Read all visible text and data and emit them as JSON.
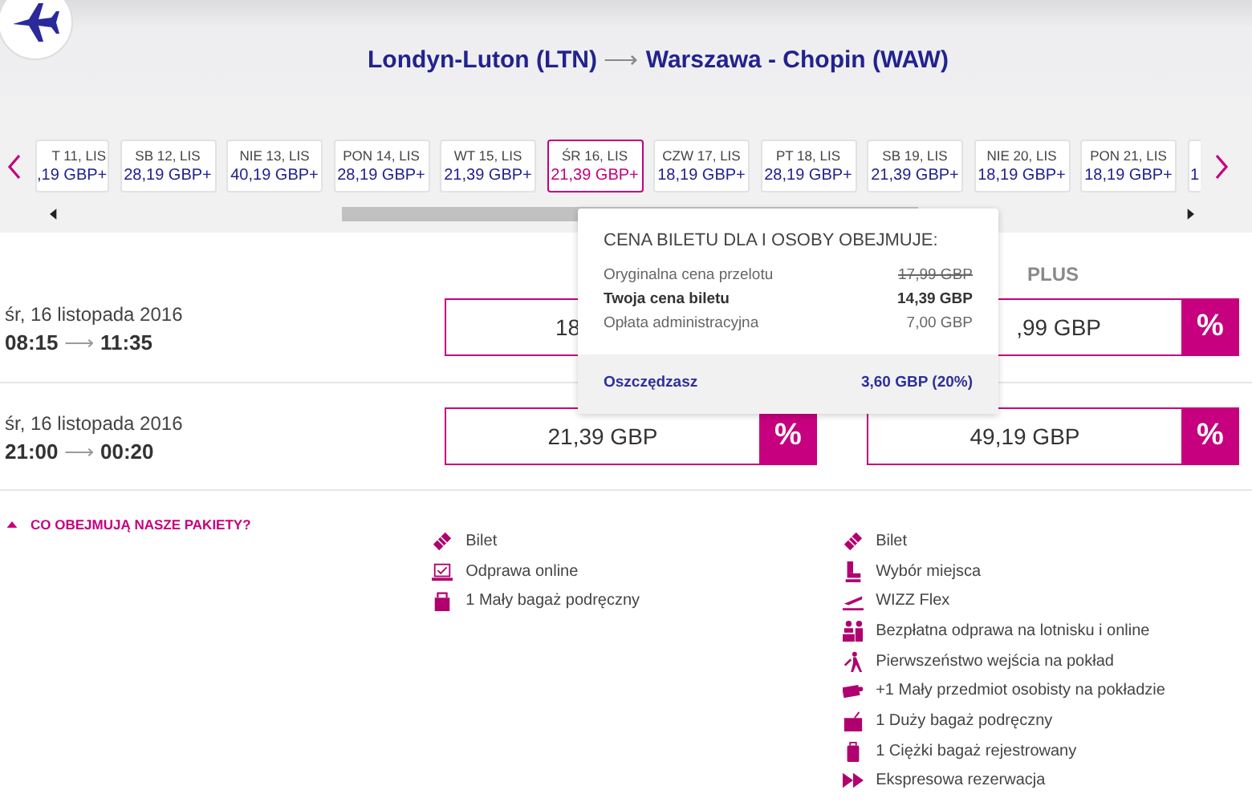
{
  "route": {
    "from": "Londyn-Luton (LTN)",
    "arrow": "⟶",
    "to": "Warszawa - Chopin (WAW)"
  },
  "dates": [
    {
      "day": "T 11, LIS",
      "price": ",19 GBP+",
      "selected": false
    },
    {
      "day": "SB 12, LIS",
      "price": "28,19 GBP+",
      "selected": false
    },
    {
      "day": "NIE 13, LIS",
      "price": "40,19 GBP+",
      "selected": false
    },
    {
      "day": "PON 14, LIS",
      "price": "28,19 GBP+",
      "selected": false
    },
    {
      "day": "WT 15, LIS",
      "price": "21,39 GBP+",
      "selected": false
    },
    {
      "day": "ŚR 16, LIS",
      "price": "21,39 GBP+",
      "selected": true
    },
    {
      "day": "CZW 17, LIS",
      "price": "18,19 GBP+",
      "selected": false
    },
    {
      "day": "PT 18, LIS",
      "price": "28,19 GBP+",
      "selected": false
    },
    {
      "day": "SB 19, LIS",
      "price": "21,39 GBP+",
      "selected": false
    },
    {
      "day": "NIE 20, LIS",
      "price": "18,19 GBP+",
      "selected": false
    },
    {
      "day": "PON 21, LIS",
      "price": "18,19 GBP+",
      "selected": false
    },
    {
      "price": "1",
      "selected": false
    }
  ],
  "columns": [
    "PLUS"
  ],
  "flights": [
    {
      "date": "śr, 16 listopada 2016",
      "departure": "08:15",
      "arrow": "⟶",
      "arrival": "11:35",
      "fares": [
        {
          "price": "18"
        },
        {
          "price": ",99 GBP",
          "badge": "%"
        }
      ]
    },
    {
      "date": "śr, 16 listopada 2016",
      "departure": "21:00",
      "arrow": "⟶",
      "arrival": "00:20",
      "fares": [
        {
          "price": "21,39 GBP",
          "badge": "%"
        },
        {
          "price": "49,19 GBP",
          "badge": "%"
        }
      ]
    }
  ],
  "tooltip": {
    "title": "CENA BILETU DLA I OSOBY OBEJMUJE:",
    "rows": [
      {
        "label": "Oryginalna cena przelotu",
        "value": "17,99 GBP",
        "kind": "struck"
      },
      {
        "label": "Twoja cena biletu",
        "value": "14,39 GBP",
        "kind": "bold"
      },
      {
        "label": "Opłata administracyjna",
        "value": "7,00 GBP",
        "kind": "plain"
      }
    ],
    "footer": {
      "label": "Oszczędzasz",
      "value": "3,60 GBP (20%)"
    }
  },
  "packages_toggle": {
    "label": "CO OBEJMUJĄ NASZE PAKIETY?",
    "expanded": true
  },
  "packages": [
    [
      {
        "kind": "ticket",
        "text": "Bilet"
      },
      {
        "kind": "laptop",
        "text": "Odprawa online"
      },
      {
        "kind": "bag",
        "text": "1 Mały bagaż podręczny"
      }
    ],
    [
      {
        "kind": "ticket",
        "text": "Bilet"
      },
      {
        "kind": "seat",
        "text": "Wybór miejsca"
      },
      {
        "kind": "takeoff",
        "text": "WIZZ Flex"
      },
      {
        "kind": "people",
        "text": "Bezpłatna odprawa na lotnisku i online"
      },
      {
        "kind": "walker",
        "text": "Pierwszeństwo wejścia na pokład"
      },
      {
        "kind": "item",
        "text": "+1 Mały przedmiot osobisty na pokładzie"
      },
      {
        "kind": "trolley",
        "text": "1 Duży bagaż podręczny"
      },
      {
        "kind": "suitcase",
        "text": "1 Ciężki bagaż rejestrowany"
      },
      {
        "kind": "forward",
        "text": "Ekspresowa rezerwacja"
      }
    ]
  ]
}
